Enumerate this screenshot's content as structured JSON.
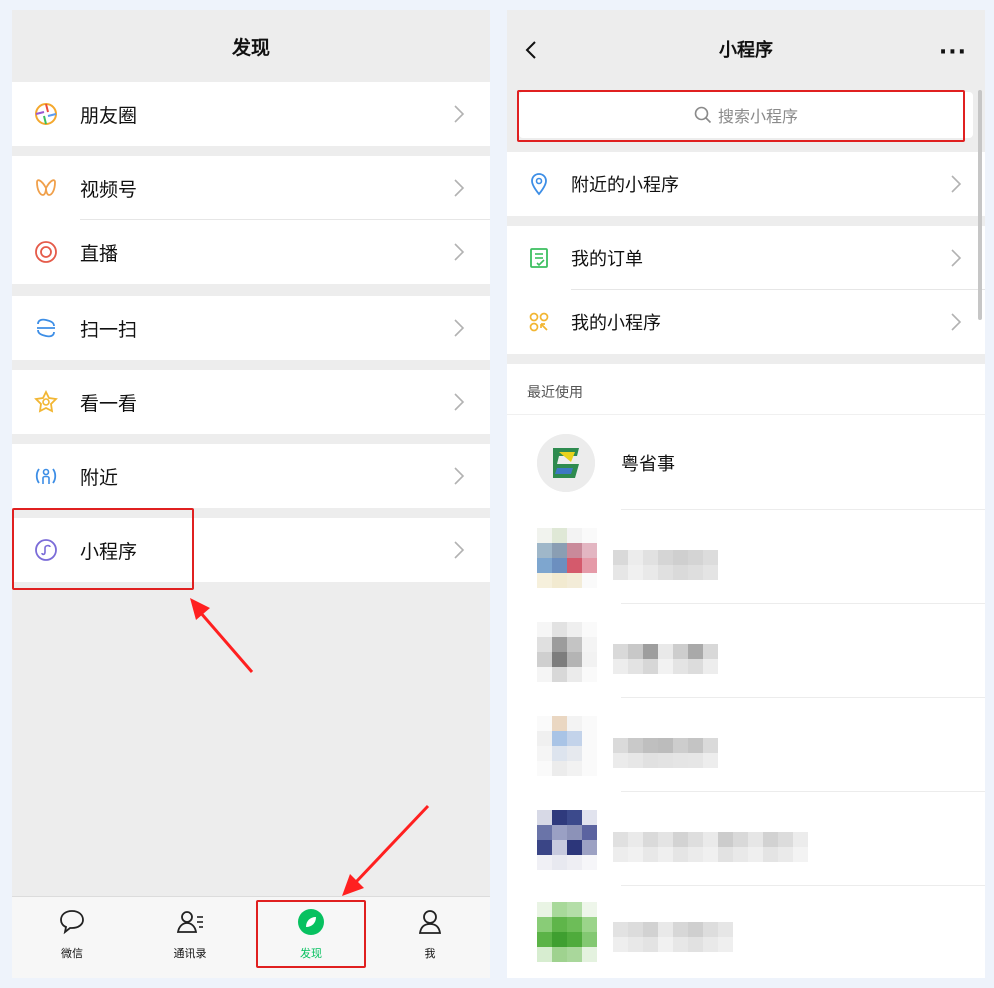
{
  "left": {
    "title": "发现",
    "items": [
      {
        "label": "朋友圈"
      },
      {
        "label": "视频号"
      },
      {
        "label": "直播"
      },
      {
        "label": "扫一扫"
      },
      {
        "label": "看一看"
      },
      {
        "label": "附近"
      },
      {
        "label": "小程序"
      }
    ],
    "tabs": [
      {
        "label": "微信"
      },
      {
        "label": "通讯录"
      },
      {
        "label": "发现"
      },
      {
        "label": "我"
      }
    ]
  },
  "right": {
    "title": "小程序",
    "more": "···",
    "search_placeholder": "搜索小程序",
    "items": [
      {
        "label": "附近的小程序"
      },
      {
        "label": "我的订单"
      },
      {
        "label": "我的小程序"
      }
    ],
    "recent_title": "最近使用",
    "recent_apps": [
      {
        "name": "粤省事"
      }
    ]
  },
  "colors": {
    "highlight": "#e02020",
    "active_tab": "#07c160"
  }
}
